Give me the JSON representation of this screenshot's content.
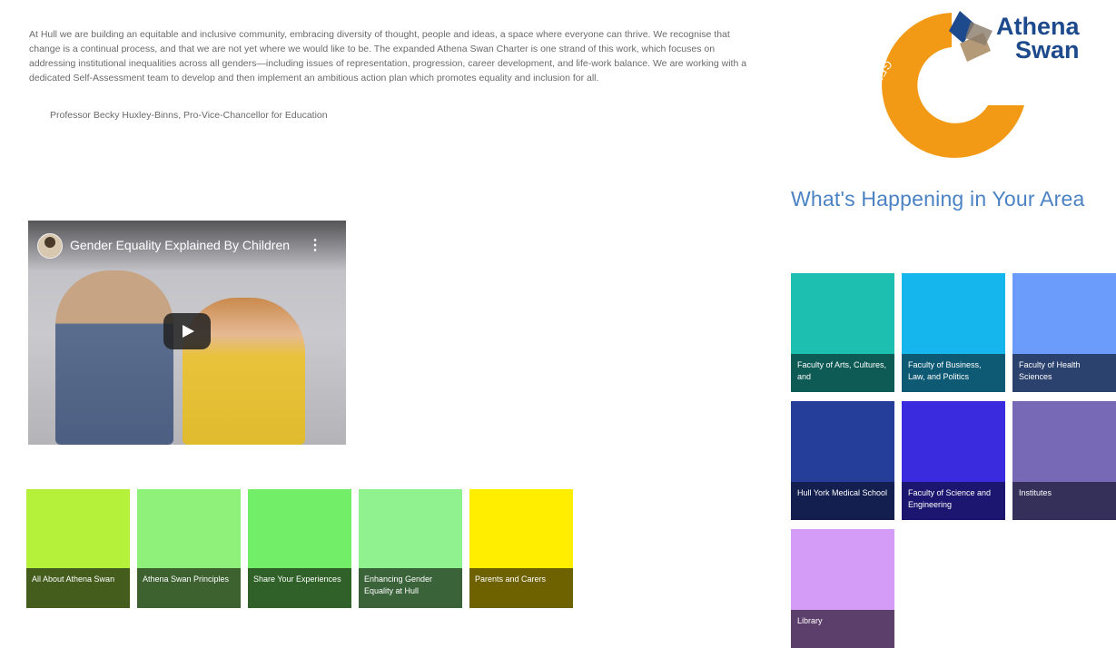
{
  "intro": {
    "paragraph": "At Hull we are building an equitable and inclusive community, embracing diversity of thought, people and ideas, a space where everyone can thrive. We recognise that change is a continual process, and that we are not yet where we would like to be. The expanded Athena Swan Charter is one strand of this work, which focuses on addressing institutional inequalities across all genders—including issues of representation, progression, career development, and life-work balance. We are working with a dedicated Self-Assessment team to develop and then implement an ambitious action plan which promotes equality and inclusion for all.",
    "attribution": "Professor Becky Huxley-Binns, Pro-Vice-Chancellor for Education"
  },
  "logo": {
    "line1": "Athena",
    "line2": "Swan",
    "ring_text": "GENDER CHARTER",
    "colors": {
      "ring": "#f29a16",
      "name": "#1d4a8d",
      "arrow_dark": "#1d4a8d",
      "arrow_light": "#b59a78"
    }
  },
  "video": {
    "title": "Gender Equality Explained By Children",
    "menu_glyph": "⋮"
  },
  "section": {
    "title": "What's Happening in Your Area"
  },
  "links": [
    {
      "label": "All About Athena Swan",
      "color": "#b5f03a",
      "label_bg": "#445d1c"
    },
    {
      "label": "Athena Swan Principles",
      "color": "#8ff07a",
      "label_bg": "#3d6230"
    },
    {
      "label": "Share Your Experiences",
      "color": "#72ee68",
      "label_bg": "#2f6128"
    },
    {
      "label": "Enhancing Gender Equality at Hull",
      "color": "#8ff28e",
      "label_bg": "#3a6339"
    },
    {
      "label": "Parents and Carers",
      "color": "#ffee00",
      "label_bg": "#6e6200"
    }
  ],
  "faculties": [
    {
      "label": "Faculty of Arts, Cultures, and",
      "color": "#1dbfb0",
      "label_bg": "#0e5a54"
    },
    {
      "label": "Faculty of Business, Law, and Politics",
      "color": "#15b6ee",
      "label_bg": "#0e5a75"
    },
    {
      "label": "Faculty of Health Sciences",
      "color": "#6b9cfb",
      "label_bg": "#2c426e"
    },
    {
      "label": "Hull York Medical School",
      "color": "#243e9a",
      "label_bg": "#131f4e"
    },
    {
      "label": "Faculty of Science and Engineering",
      "color": "#3a2cde",
      "label_bg": "#1d1670"
    },
    {
      "label": "Institutes",
      "color": "#7769b6",
      "label_bg": "#34305a"
    },
    {
      "label": "Library",
      "color": "#d59cf7",
      "label_bg": "#5d3f6c"
    }
  ]
}
